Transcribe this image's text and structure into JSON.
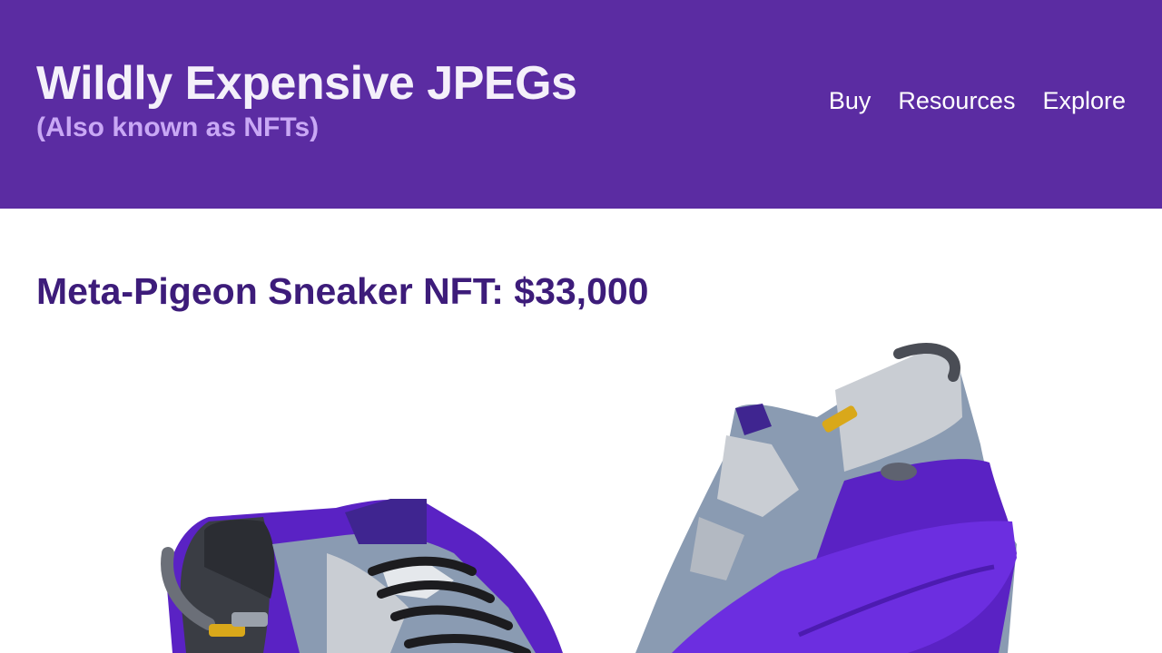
{
  "header": {
    "title": "Wildly Expensive JPEGs",
    "subtitle": "(Also known as NFTs)",
    "nav": [
      "Buy",
      "Resources",
      "Explore"
    ]
  },
  "product": {
    "title": "Meta-Pigeon Sneaker NFT: $33,000",
    "image_alt": "Pair of purple and silver Meta-Pigeon sneakers"
  },
  "colors": {
    "header_bg": "#5b2ca2",
    "title_text": "#f4f0fa",
    "subtitle_text": "#c9a8f5",
    "heading_text": "#3d1c7a",
    "sneaker_purple": "#5a22c4",
    "sneaker_silver": "#c9cdd3"
  }
}
